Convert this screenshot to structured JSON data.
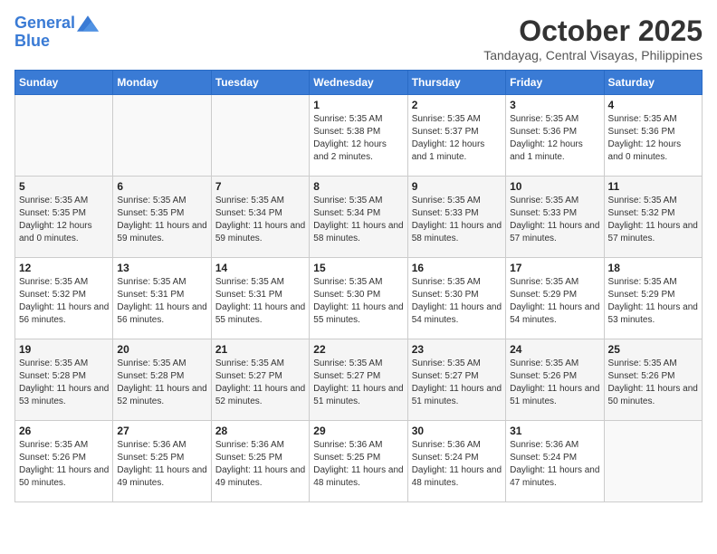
{
  "logo": {
    "line1": "General",
    "line2": "Blue"
  },
  "title": "October 2025",
  "location": "Tandayag, Central Visayas, Philippines",
  "weekdays": [
    "Sunday",
    "Monday",
    "Tuesday",
    "Wednesday",
    "Thursday",
    "Friday",
    "Saturday"
  ],
  "weeks": [
    [
      {
        "day": "",
        "sunrise": "",
        "sunset": "",
        "daylight": ""
      },
      {
        "day": "",
        "sunrise": "",
        "sunset": "",
        "daylight": ""
      },
      {
        "day": "",
        "sunrise": "",
        "sunset": "",
        "daylight": ""
      },
      {
        "day": "1",
        "sunrise": "Sunrise: 5:35 AM",
        "sunset": "Sunset: 5:38 PM",
        "daylight": "Daylight: 12 hours and 2 minutes."
      },
      {
        "day": "2",
        "sunrise": "Sunrise: 5:35 AM",
        "sunset": "Sunset: 5:37 PM",
        "daylight": "Daylight: 12 hours and 1 minute."
      },
      {
        "day": "3",
        "sunrise": "Sunrise: 5:35 AM",
        "sunset": "Sunset: 5:36 PM",
        "daylight": "Daylight: 12 hours and 1 minute."
      },
      {
        "day": "4",
        "sunrise": "Sunrise: 5:35 AM",
        "sunset": "Sunset: 5:36 PM",
        "daylight": "Daylight: 12 hours and 0 minutes."
      }
    ],
    [
      {
        "day": "5",
        "sunrise": "Sunrise: 5:35 AM",
        "sunset": "Sunset: 5:35 PM",
        "daylight": "Daylight: 12 hours and 0 minutes."
      },
      {
        "day": "6",
        "sunrise": "Sunrise: 5:35 AM",
        "sunset": "Sunset: 5:35 PM",
        "daylight": "Daylight: 11 hours and 59 minutes."
      },
      {
        "day": "7",
        "sunrise": "Sunrise: 5:35 AM",
        "sunset": "Sunset: 5:34 PM",
        "daylight": "Daylight: 11 hours and 59 minutes."
      },
      {
        "day": "8",
        "sunrise": "Sunrise: 5:35 AM",
        "sunset": "Sunset: 5:34 PM",
        "daylight": "Daylight: 11 hours and 58 minutes."
      },
      {
        "day": "9",
        "sunrise": "Sunrise: 5:35 AM",
        "sunset": "Sunset: 5:33 PM",
        "daylight": "Daylight: 11 hours and 58 minutes."
      },
      {
        "day": "10",
        "sunrise": "Sunrise: 5:35 AM",
        "sunset": "Sunset: 5:33 PM",
        "daylight": "Daylight: 11 hours and 57 minutes."
      },
      {
        "day": "11",
        "sunrise": "Sunrise: 5:35 AM",
        "sunset": "Sunset: 5:32 PM",
        "daylight": "Daylight: 11 hours and 57 minutes."
      }
    ],
    [
      {
        "day": "12",
        "sunrise": "Sunrise: 5:35 AM",
        "sunset": "Sunset: 5:32 PM",
        "daylight": "Daylight: 11 hours and 56 minutes."
      },
      {
        "day": "13",
        "sunrise": "Sunrise: 5:35 AM",
        "sunset": "Sunset: 5:31 PM",
        "daylight": "Daylight: 11 hours and 56 minutes."
      },
      {
        "day": "14",
        "sunrise": "Sunrise: 5:35 AM",
        "sunset": "Sunset: 5:31 PM",
        "daylight": "Daylight: 11 hours and 55 minutes."
      },
      {
        "day": "15",
        "sunrise": "Sunrise: 5:35 AM",
        "sunset": "Sunset: 5:30 PM",
        "daylight": "Daylight: 11 hours and 55 minutes."
      },
      {
        "day": "16",
        "sunrise": "Sunrise: 5:35 AM",
        "sunset": "Sunset: 5:30 PM",
        "daylight": "Daylight: 11 hours and 54 minutes."
      },
      {
        "day": "17",
        "sunrise": "Sunrise: 5:35 AM",
        "sunset": "Sunset: 5:29 PM",
        "daylight": "Daylight: 11 hours and 54 minutes."
      },
      {
        "day": "18",
        "sunrise": "Sunrise: 5:35 AM",
        "sunset": "Sunset: 5:29 PM",
        "daylight": "Daylight: 11 hours and 53 minutes."
      }
    ],
    [
      {
        "day": "19",
        "sunrise": "Sunrise: 5:35 AM",
        "sunset": "Sunset: 5:28 PM",
        "daylight": "Daylight: 11 hours and 53 minutes."
      },
      {
        "day": "20",
        "sunrise": "Sunrise: 5:35 AM",
        "sunset": "Sunset: 5:28 PM",
        "daylight": "Daylight: 11 hours and 52 minutes."
      },
      {
        "day": "21",
        "sunrise": "Sunrise: 5:35 AM",
        "sunset": "Sunset: 5:27 PM",
        "daylight": "Daylight: 11 hours and 52 minutes."
      },
      {
        "day": "22",
        "sunrise": "Sunrise: 5:35 AM",
        "sunset": "Sunset: 5:27 PM",
        "daylight": "Daylight: 11 hours and 51 minutes."
      },
      {
        "day": "23",
        "sunrise": "Sunrise: 5:35 AM",
        "sunset": "Sunset: 5:27 PM",
        "daylight": "Daylight: 11 hours and 51 minutes."
      },
      {
        "day": "24",
        "sunrise": "Sunrise: 5:35 AM",
        "sunset": "Sunset: 5:26 PM",
        "daylight": "Daylight: 11 hours and 51 minutes."
      },
      {
        "day": "25",
        "sunrise": "Sunrise: 5:35 AM",
        "sunset": "Sunset: 5:26 PM",
        "daylight": "Daylight: 11 hours and 50 minutes."
      }
    ],
    [
      {
        "day": "26",
        "sunrise": "Sunrise: 5:35 AM",
        "sunset": "Sunset: 5:26 PM",
        "daylight": "Daylight: 11 hours and 50 minutes."
      },
      {
        "day": "27",
        "sunrise": "Sunrise: 5:36 AM",
        "sunset": "Sunset: 5:25 PM",
        "daylight": "Daylight: 11 hours and 49 minutes."
      },
      {
        "day": "28",
        "sunrise": "Sunrise: 5:36 AM",
        "sunset": "Sunset: 5:25 PM",
        "daylight": "Daylight: 11 hours and 49 minutes."
      },
      {
        "day": "29",
        "sunrise": "Sunrise: 5:36 AM",
        "sunset": "Sunset: 5:25 PM",
        "daylight": "Daylight: 11 hours and 48 minutes."
      },
      {
        "day": "30",
        "sunrise": "Sunrise: 5:36 AM",
        "sunset": "Sunset: 5:24 PM",
        "daylight": "Daylight: 11 hours and 48 minutes."
      },
      {
        "day": "31",
        "sunrise": "Sunrise: 5:36 AM",
        "sunset": "Sunset: 5:24 PM",
        "daylight": "Daylight: 11 hours and 47 minutes."
      },
      {
        "day": "",
        "sunrise": "",
        "sunset": "",
        "daylight": ""
      }
    ]
  ]
}
